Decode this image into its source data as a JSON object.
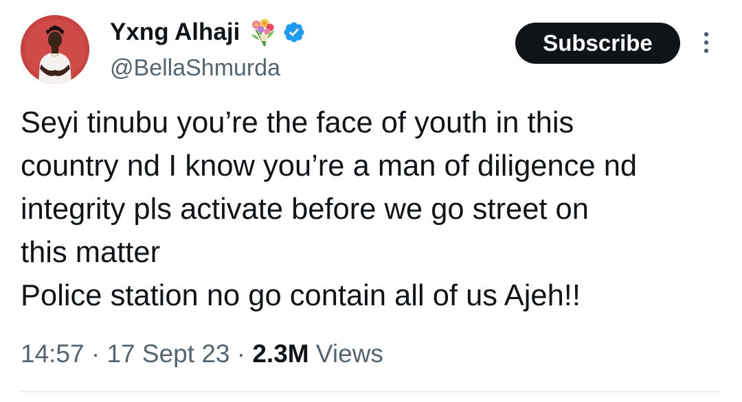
{
  "author": {
    "display_name": "Yxng Alhaji",
    "handle": "@BellaShmurda",
    "verified": true,
    "name_emoji": "bouquet-icon",
    "avatar": "avatar"
  },
  "header": {
    "subscribe_label": "Subscribe",
    "more_icon": "more-vertical-icon"
  },
  "tweet": {
    "lines": [
      "Seyi tinubu you’re the face of youth in this",
      "country nd I know you’re a man of diligence nd",
      "integrity pls activate before we go street on",
      "this matter",
      "Police station no go contain all of us Ajeh!!"
    ],
    "time": "14:57",
    "date": "17 Sept 23",
    "views_count": "2.3M",
    "views_label": "Views"
  },
  "colors": {
    "text_primary": "#0f1419",
    "text_secondary": "#536471",
    "verified_blue": "#1d9bf0",
    "button_bg": "#0f1419",
    "button_text": "#ffffff",
    "avatar_bg": "#c94342"
  }
}
